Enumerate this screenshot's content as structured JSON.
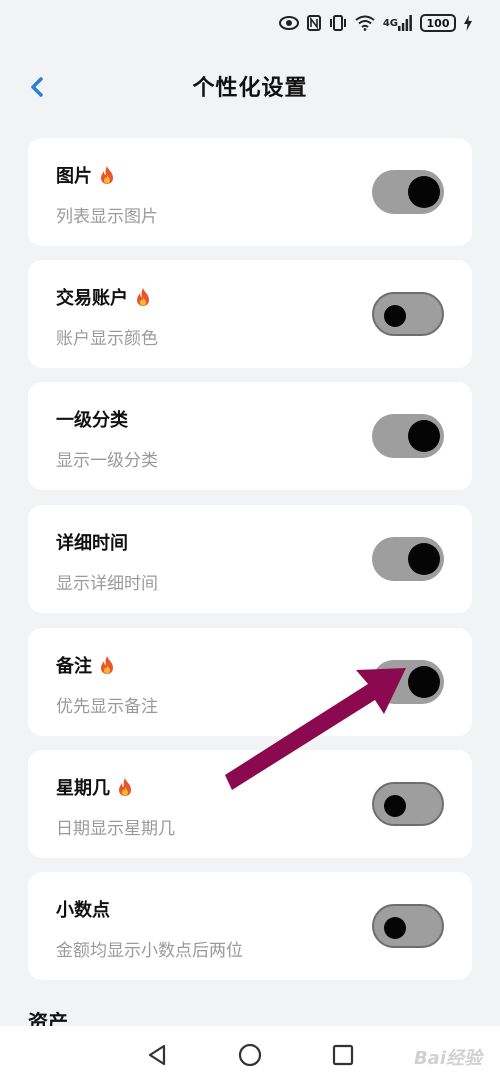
{
  "status_bar": {
    "network": "4G",
    "battery": "100"
  },
  "header": {
    "title": "个性化设置"
  },
  "settings": [
    {
      "title": "图片",
      "subtitle": "列表显示图片",
      "hot": true,
      "enabled": true
    },
    {
      "title": "交易账户",
      "subtitle": "账户显示颜色",
      "hot": true,
      "enabled": false
    },
    {
      "title": "一级分类",
      "subtitle": "显示一级分类",
      "hot": false,
      "enabled": true
    },
    {
      "title": "详细时间",
      "subtitle": "显示详细时间",
      "hot": false,
      "enabled": true
    },
    {
      "title": "备注",
      "subtitle": "优先显示备注",
      "hot": true,
      "enabled": true
    },
    {
      "title": "星期几",
      "subtitle": "日期显示星期几",
      "hot": true,
      "enabled": false
    },
    {
      "title": "小数点",
      "subtitle": "金额均显示小数点后两位",
      "hot": false,
      "enabled": false
    }
  ],
  "section": {
    "title": "资产"
  },
  "watermark": "Bai经验",
  "colors": {
    "background": "#f2f3f5",
    "back_arrow": "#2a7fd4",
    "toggle_track": "#9e9e9e",
    "annotation_arrow": "#8b0a4f"
  }
}
